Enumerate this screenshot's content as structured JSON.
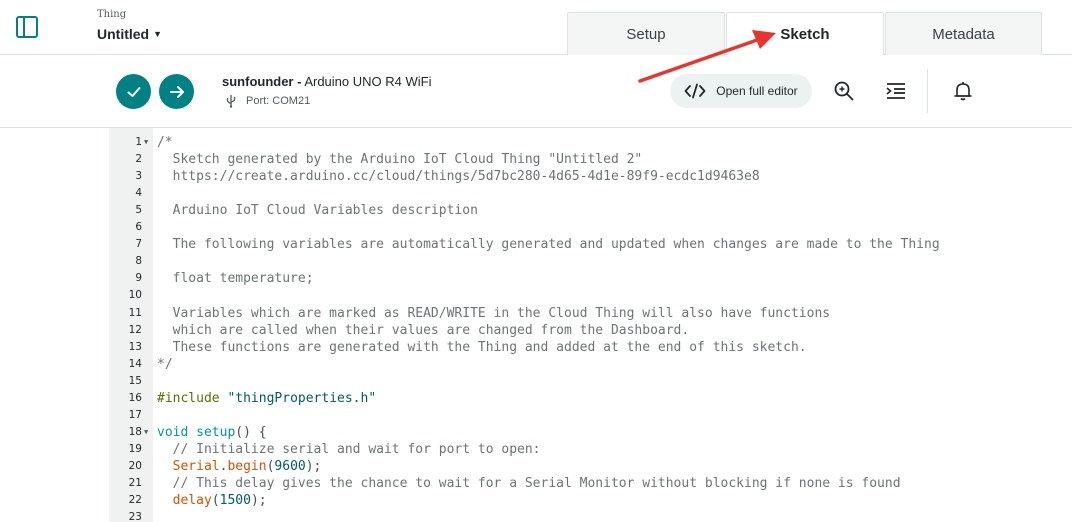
{
  "header": {
    "thing_caption": "Thing",
    "thing_name": "Untitled",
    "tabs": [
      {
        "label": "Setup",
        "active": false
      },
      {
        "label": "Sketch",
        "active": true
      },
      {
        "label": "Metadata",
        "active": false
      }
    ]
  },
  "toolbar": {
    "device_owner": "sunfounder -",
    "device_board": " Arduino UNO R4 WiFi",
    "port": "Port: COM21",
    "open_editor_label": "Open full editor"
  },
  "colors": {
    "accent": "#008184",
    "annotation_arrow": "#e8352b"
  },
  "icons": {
    "sidebar_toggle": "sidebar-toggle-icon",
    "verify": "checkmark-icon",
    "upload": "arrow-right-icon",
    "usb": "usb-icon",
    "code": "code-brackets-icon",
    "search": "search-icon",
    "indent": "indent-icon",
    "bell": "bell-icon"
  },
  "code_lines": [
    {
      "n": "1",
      "fold": true,
      "parts": [
        {
          "t": "/*",
          "c": "c-comment"
        }
      ]
    },
    {
      "n": "2",
      "fold": false,
      "parts": [
        {
          "t": "  Sketch generated by the Arduino IoT Cloud Thing \"Untitled 2\"",
          "c": "c-comment"
        }
      ]
    },
    {
      "n": "3",
      "fold": false,
      "parts": [
        {
          "t": "  https://create.arduino.cc/cloud/things/5d7bc280-4d65-4d1e-89f9-ecdc1d9463e8",
          "c": "c-comment"
        }
      ]
    },
    {
      "n": "4",
      "fold": false,
      "parts": []
    },
    {
      "n": "5",
      "fold": false,
      "parts": [
        {
          "t": "  Arduino IoT Cloud Variables description",
          "c": "c-comment"
        }
      ]
    },
    {
      "n": "6",
      "fold": false,
      "parts": []
    },
    {
      "n": "7",
      "fold": false,
      "parts": [
        {
          "t": "  The following variables are automatically generated and updated when changes are made to the Thing",
          "c": "c-comment"
        }
      ]
    },
    {
      "n": "8",
      "fold": false,
      "parts": []
    },
    {
      "n": "9",
      "fold": false,
      "parts": [
        {
          "t": "  float temperature;",
          "c": "c-comment"
        }
      ]
    },
    {
      "n": "10",
      "fold": false,
      "parts": []
    },
    {
      "n": "11",
      "fold": false,
      "parts": [
        {
          "t": "  Variables which are marked as READ/WRITE in the Cloud Thing will also have functions",
          "c": "c-comment"
        }
      ]
    },
    {
      "n": "12",
      "fold": false,
      "parts": [
        {
          "t": "  which are called when their values are changed from the Dashboard.",
          "c": "c-comment"
        }
      ]
    },
    {
      "n": "13",
      "fold": false,
      "parts": [
        {
          "t": "  These functions are generated with the Thing and added at the end of this sketch.",
          "c": "c-comment"
        }
      ]
    },
    {
      "n": "14",
      "fold": false,
      "parts": [
        {
          "t": "*/",
          "c": "c-comment"
        }
      ]
    },
    {
      "n": "15",
      "fold": false,
      "parts": []
    },
    {
      "n": "16",
      "fold": false,
      "parts": [
        {
          "t": "#include ",
          "c": "c-pre"
        },
        {
          "t": "\"thingProperties.h\"",
          "c": "c-str"
        }
      ]
    },
    {
      "n": "17",
      "fold": false,
      "parts": []
    },
    {
      "n": "18",
      "fold": true,
      "parts": [
        {
          "t": "void",
          "c": "c-kw"
        },
        {
          "t": " ",
          "c": ""
        },
        {
          "t": "setup",
          "c": "c-kw"
        },
        {
          "t": "() {",
          "c": ""
        }
      ]
    },
    {
      "n": "19",
      "fold": false,
      "parts": [
        {
          "t": "  // Initialize serial and wait for port to open:",
          "c": "c-comment"
        }
      ]
    },
    {
      "n": "20",
      "fold": false,
      "parts": [
        {
          "t": "  ",
          "c": ""
        },
        {
          "t": "Serial",
          "c": "c-fn"
        },
        {
          "t": ".",
          "c": ""
        },
        {
          "t": "begin",
          "c": "c-fn"
        },
        {
          "t": "(",
          "c": ""
        },
        {
          "t": "9600",
          "c": "c-num"
        },
        {
          "t": ");",
          "c": ""
        }
      ]
    },
    {
      "n": "21",
      "fold": false,
      "parts": [
        {
          "t": "  // This delay gives the chance to wait for a Serial Monitor without blocking if none is found",
          "c": "c-comment"
        }
      ]
    },
    {
      "n": "22",
      "fold": false,
      "parts": [
        {
          "t": "  ",
          "c": ""
        },
        {
          "t": "delay",
          "c": "c-fn"
        },
        {
          "t": "(",
          "c": ""
        },
        {
          "t": "1500",
          "c": "c-num"
        },
        {
          "t": ");",
          "c": ""
        }
      ]
    },
    {
      "n": "23",
      "fold": false,
      "parts": []
    }
  ]
}
